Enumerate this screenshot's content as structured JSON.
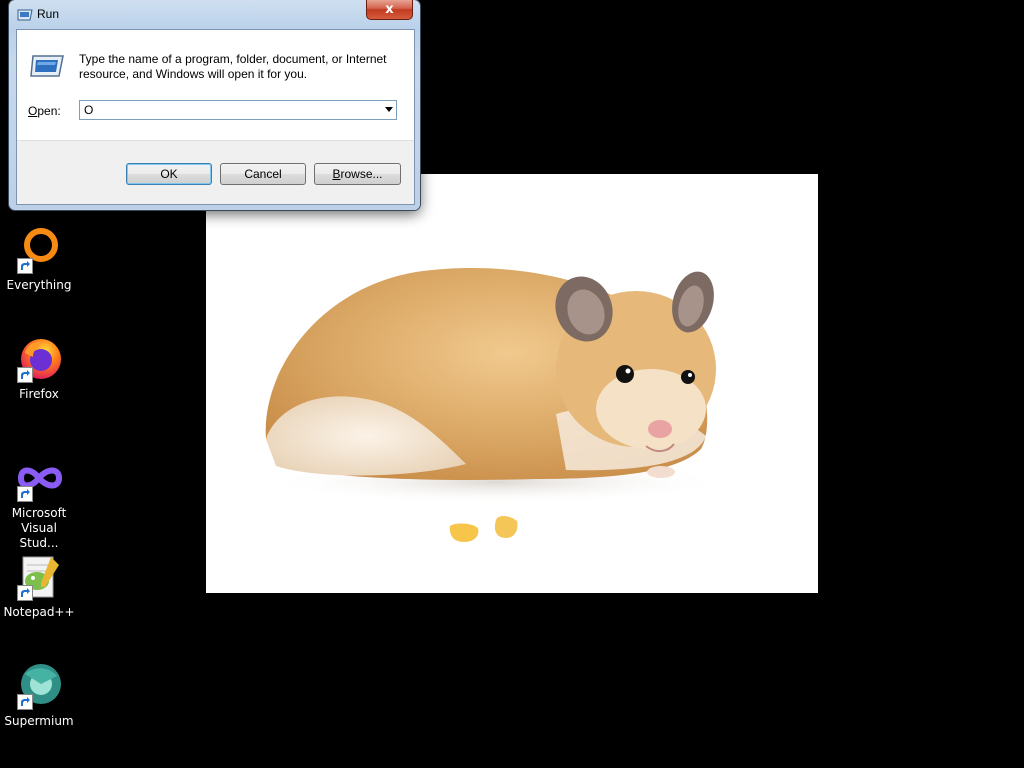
{
  "desktop": {
    "icons": [
      {
        "label": "Everything"
      },
      {
        "label": "Firefox"
      },
      {
        "label": "Microsoft Visual Stud..."
      },
      {
        "label": "Notepad++"
      },
      {
        "label": "Supermium"
      }
    ]
  },
  "run_dialog": {
    "title": "Run",
    "close_label": "x",
    "description": "Type the name of a program, folder, document, or Internet resource, and Windows will open it for you.",
    "open_label_prefix": "",
    "open_label_accel": "O",
    "open_label_rest": "pen:",
    "open_value": "O",
    "ok_label": "OK",
    "cancel_label": "Cancel",
    "browse_label_accel": "B",
    "browse_label_rest": "rowse..."
  },
  "colors": {
    "desktop_bg": "#000000",
    "default_button_border": "#3c7fb1"
  }
}
